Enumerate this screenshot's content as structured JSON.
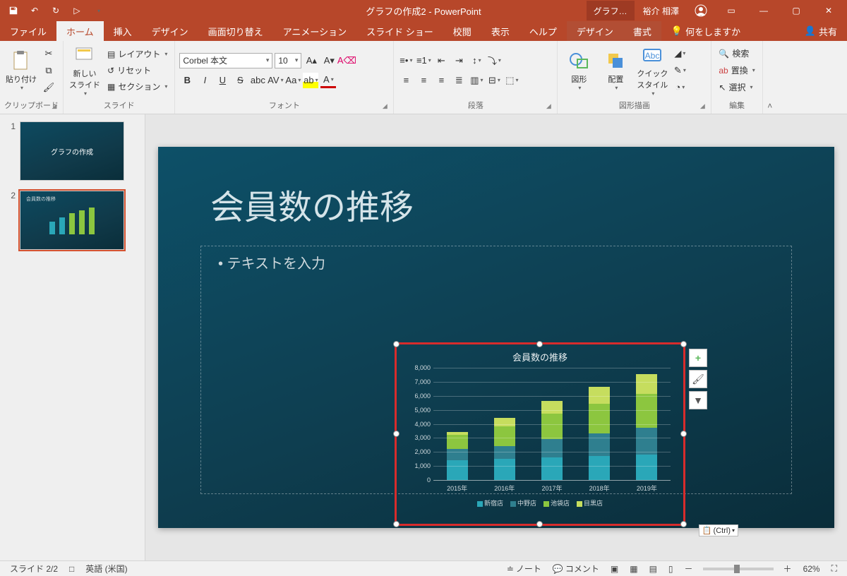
{
  "title": "グラフの作成2 - PowerPoint",
  "context_tab_group": "グラフ…",
  "user_name": "裕介 相澤",
  "tabs": {
    "file": "ファイル",
    "home": "ホーム",
    "insert": "挿入",
    "design": "デザイン",
    "transitions": "画面切り替え",
    "animations": "アニメーション",
    "slideshow": "スライド ショー",
    "review": "校閲",
    "view": "表示",
    "help": "ヘルプ",
    "ctx_design": "デザイン",
    "ctx_format": "書式",
    "tell_me": "何をしますか",
    "share": "共有"
  },
  "groups": {
    "clipboard": "クリップボード",
    "slides": "スライド",
    "font": "フォント",
    "paragraph": "段落",
    "drawing": "図形描画",
    "editing": "編集"
  },
  "btn": {
    "paste": "貼り付け",
    "new_slide": "新しい\nスライド",
    "layout": "レイアウト",
    "reset": "リセット",
    "section": "セクション",
    "shapes": "図形",
    "arrange": "配置",
    "quick_styles": "クイック\nスタイル",
    "find": "検索",
    "replace": "置換",
    "select": "選択"
  },
  "font": {
    "name": "Corbel 本文",
    "size": "10"
  },
  "slide1": {
    "title": "グラフの作成"
  },
  "slide2": {
    "title": "会員数の推移",
    "placeholder": "• テキストを入力"
  },
  "chart_data": {
    "type": "bar",
    "title": "会員数の推移",
    "categories": [
      "2015年",
      "2016年",
      "2017年",
      "2018年",
      "2019年"
    ],
    "series": [
      {
        "name": "新宿店",
        "color": "#2aa7b8",
        "values": [
          1400,
          1500,
          1600,
          1700,
          1800
        ]
      },
      {
        "name": "中野店",
        "color": "#2f7f8f",
        "values": [
          800,
          900,
          1300,
          1600,
          1900
        ]
      },
      {
        "name": "池袋店",
        "color": "#8cc63f",
        "values": [
          1000,
          1400,
          1800,
          2100,
          2400
        ]
      },
      {
        "name": "目黒店",
        "color": "#c6dd5e",
        "values": [
          200,
          600,
          900,
          1200,
          1400
        ]
      }
    ],
    "ylabel": "",
    "xlabel": "",
    "ylim": [
      0,
      8000
    ],
    "ystep": 1000
  },
  "paste_options": "(Ctrl)",
  "status": {
    "slide_info": "スライド 2/2",
    "language": "英語 (米国)",
    "notes": "ノート",
    "comments": "コメント",
    "zoom": "62%"
  },
  "thumb2_title": "会員数の推移"
}
